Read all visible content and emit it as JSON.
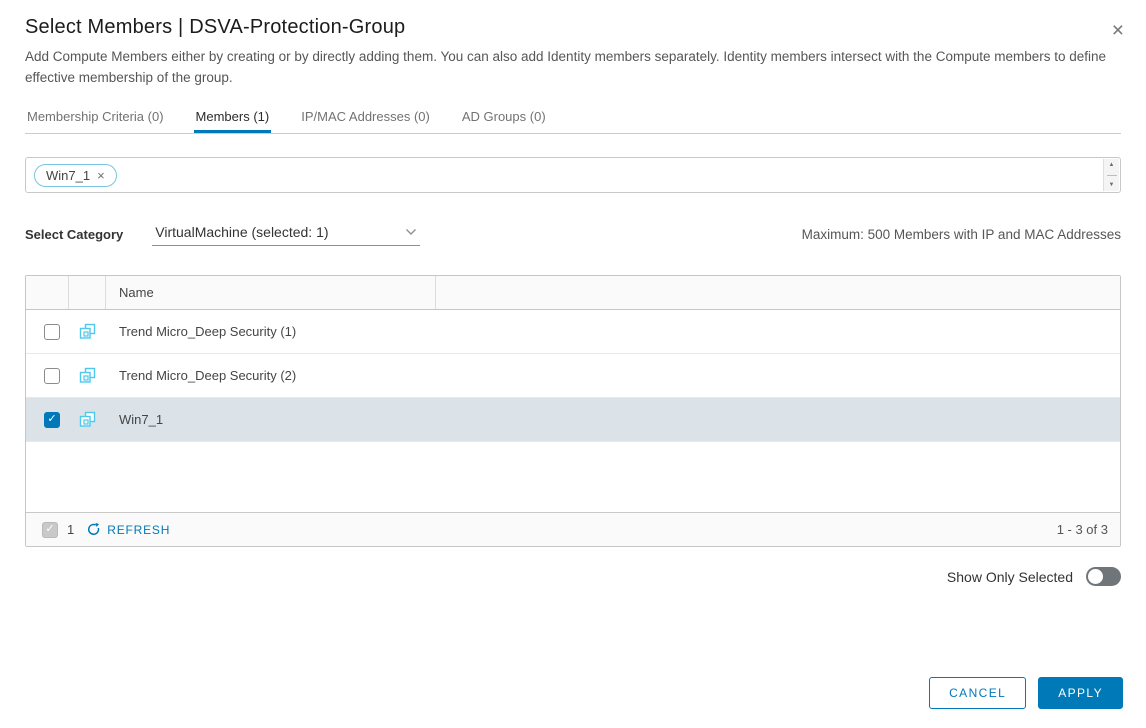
{
  "dialog": {
    "title": "Select Members | DSVA-Protection-Group",
    "description": "Add Compute Members either by creating or by directly adding them. You can also add Identity members separately. Identity members intersect with the Compute members to define effective membership of the group."
  },
  "tabs": [
    {
      "label": "Membership Criteria (0)",
      "active": false
    },
    {
      "label": "Members (1)",
      "active": true
    },
    {
      "label": "IP/MAC Addresses (0)",
      "active": false
    },
    {
      "label": "AD Groups (0)",
      "active": false
    }
  ],
  "chip_bar": {
    "chips": [
      {
        "label": "Win7_1"
      }
    ]
  },
  "category": {
    "label": "Select Category",
    "selected": "VirtualMachine (selected: 1)",
    "max_note": "Maximum: 500 Members with IP and MAC Addresses"
  },
  "table": {
    "columns": [
      {
        "header": ""
      },
      {
        "header": ""
      },
      {
        "header": "Name"
      }
    ],
    "rows": [
      {
        "name": "Trend Micro_Deep Security (1)",
        "checked": false,
        "selected": false
      },
      {
        "name": "Trend Micro_Deep Security (2)",
        "checked": false,
        "selected": false
      },
      {
        "name": "Win7_1",
        "checked": true,
        "selected": true
      }
    ],
    "footer": {
      "page": "1",
      "refresh_label": "REFRESH",
      "range": "1 - 3 of 3"
    }
  },
  "show_only_selected": {
    "label": "Show Only Selected",
    "on": false
  },
  "actions": {
    "cancel": "CANCEL",
    "apply": "APPLY"
  },
  "icons": {
    "close": "×",
    "chip_remove": "×",
    "spinner_up": "▲",
    "spinner_down": "▼",
    "checkmark": "✓"
  },
  "colors": {
    "accent": "#0079b8",
    "vm_icon_cyan": "#4ec9ed",
    "selected_row": "#dbe3e9"
  }
}
